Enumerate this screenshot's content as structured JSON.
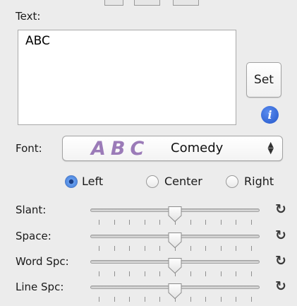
{
  "text_section": {
    "label": "Text:",
    "value": "ABC",
    "set_label": "Set",
    "info_icon": "info-icon"
  },
  "font": {
    "label": "Font:",
    "preview": "ABC",
    "selected": "Comedy",
    "popup_icon": "up-down-arrows-icon"
  },
  "alignment": {
    "options": [
      {
        "label": "Left",
        "selected": true
      },
      {
        "label": "Center",
        "selected": false
      },
      {
        "label": "Right",
        "selected": false
      }
    ]
  },
  "sliders": [
    {
      "label": "Slant:",
      "level": 0.5,
      "reset_icon": "reset-icon"
    },
    {
      "label": "Space:",
      "level": 0.5,
      "reset_icon": "reset-icon"
    },
    {
      "label": "Word Spc:",
      "level": 0.5,
      "reset_icon": "reset-icon"
    },
    {
      "label": "Line Spc:",
      "level": 0.5,
      "reset_icon": "reset-icon"
    }
  ],
  "colors": {
    "accent": "#2f6fd6",
    "font_preview": "#9b7bb8"
  }
}
